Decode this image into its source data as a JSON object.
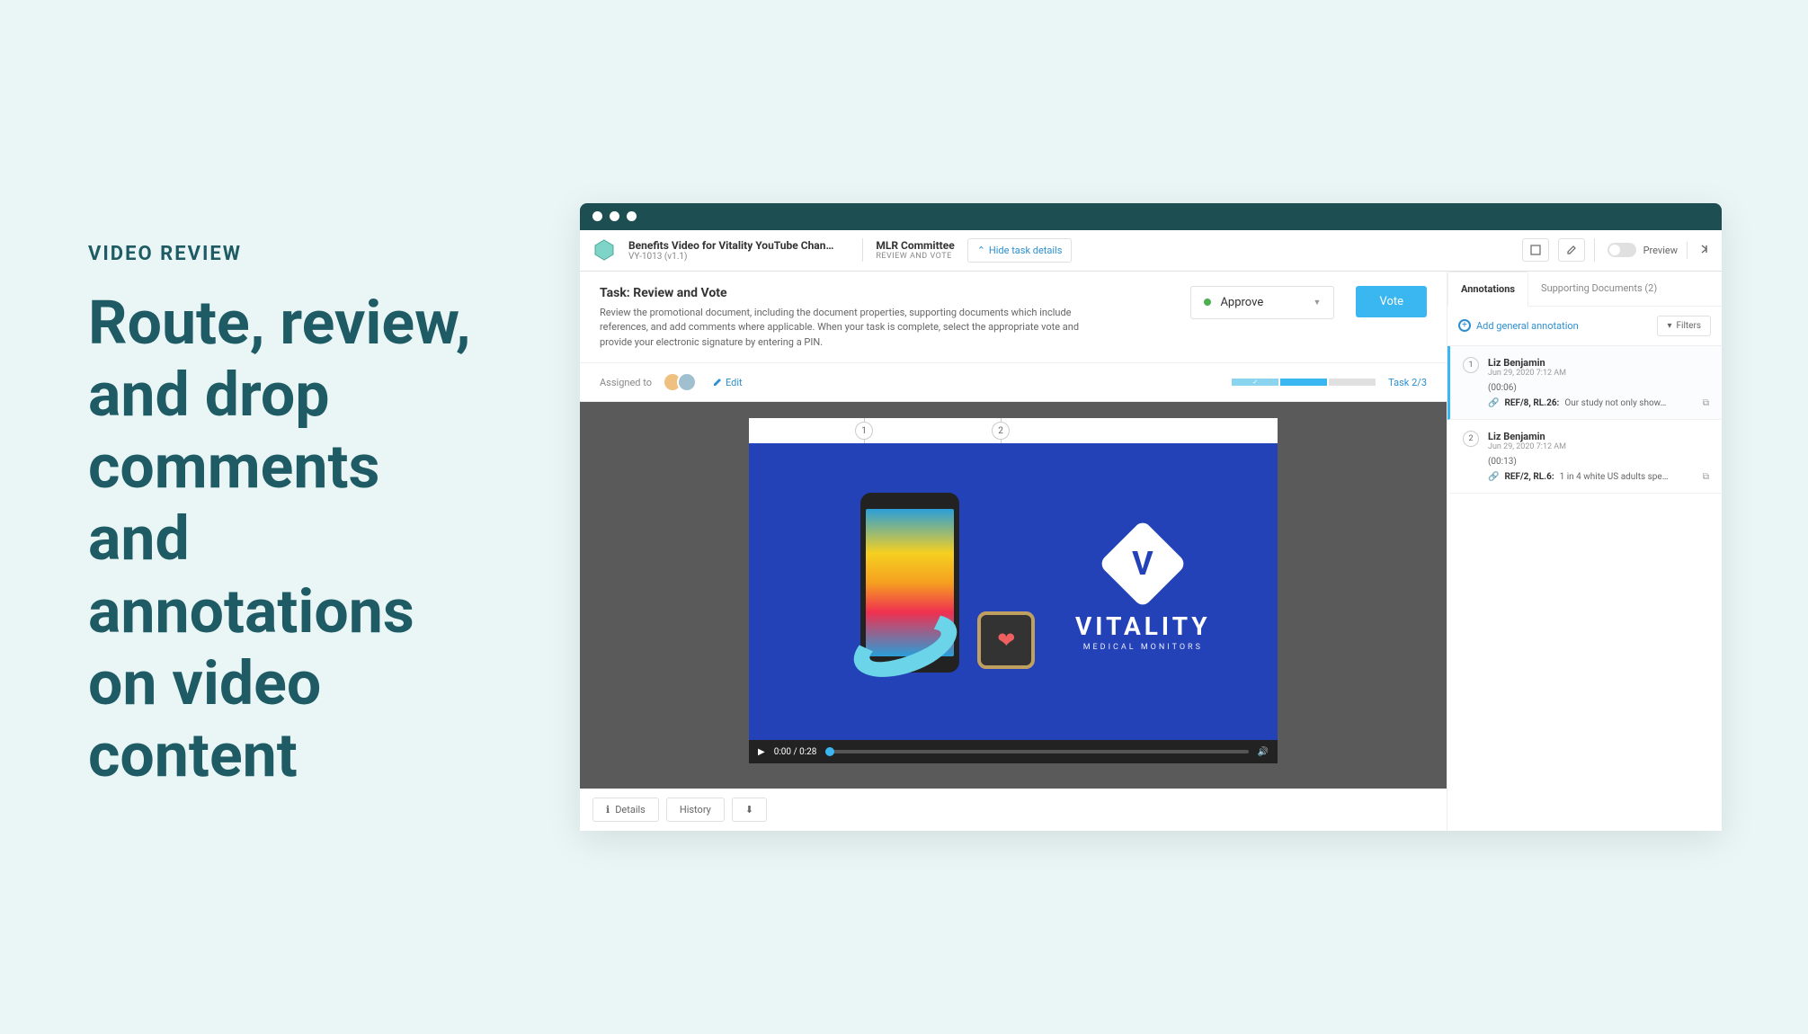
{
  "hero": {
    "eyebrow": "VIDEO REVIEW",
    "headline": "Route, review, and drop comments and annotations on video content"
  },
  "toolbar": {
    "doc_title": "Benefits Video for Vitality YouTube Chan…",
    "doc_sub": "VY-1013 (v1.1)",
    "committee": "MLR Committee",
    "committee_sub": "REVIEW AND VOTE",
    "hide_details": "Hide task details",
    "preview": "Preview"
  },
  "task": {
    "title": "Task: Review and Vote",
    "description": "Review the promotional document, including the document properties, supporting documents which include references, and add comments where applicable. When your task is complete, select the appropriate vote and provide your electronic signature by entering a PIN.",
    "approve_label": "Approve",
    "vote_label": "Vote"
  },
  "assigned": {
    "label": "Assigned to",
    "edit": "Edit",
    "task_count": "Task 2/3"
  },
  "video": {
    "time_display": "0:00 / 0:28",
    "logo_text": "VITALITY",
    "logo_sub": "MEDICAL MONITORS",
    "markers": [
      "1",
      "2"
    ]
  },
  "bottom": {
    "details": "Details",
    "history": "History"
  },
  "sidebar": {
    "tab_annotations": "Annotations",
    "tab_supporting": "Supporting Documents (2)",
    "add_annotation": "Add general annotation",
    "filters": "Filters",
    "annotations": [
      {
        "num": "1",
        "author": "Liz Benjamin",
        "date": "Jun 29, 2020 7:12 AM",
        "timestamp": "(00:06)",
        "ref": "REF/8, RL.26:",
        "text": "Our study not only show…"
      },
      {
        "num": "2",
        "author": "Liz Benjamin",
        "date": "Jun 29, 2020 7:12 AM",
        "timestamp": "(00:13)",
        "ref": "REF/2, RL.6:",
        "text": "1 in 4 white US adults spe…"
      }
    ]
  }
}
